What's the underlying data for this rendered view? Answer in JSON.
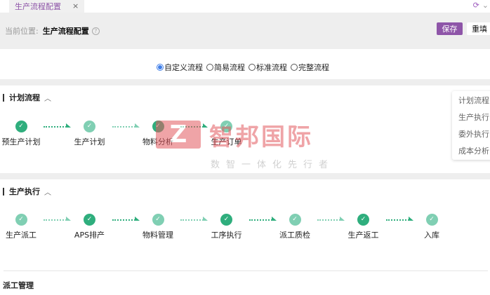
{
  "tabbar": {
    "tab_label": "生产流程配置",
    "close_icon": "×",
    "refresh_icon": "refresh-icon",
    "chevron_icon": "chevron-down-icon"
  },
  "header": {
    "location_label": "当前位置:",
    "location_value": "生产流程配置",
    "help_icon": "?",
    "save_label": "保存",
    "reset_label": "重填"
  },
  "colors": {
    "accent": "#8e55a8",
    "step_done": "#2fae7d",
    "step_light": "#80cfb3",
    "radio": "#3f7ee8"
  },
  "flow_types": [
    {
      "label": "自定义流程",
      "selected": true
    },
    {
      "label": "简易流程",
      "selected": false
    },
    {
      "label": "标准流程",
      "selected": false
    },
    {
      "label": "完整流程",
      "selected": false
    }
  ],
  "sections": [
    {
      "title": "计划流程",
      "steps": [
        {
          "label": "预生产计划",
          "tone": "dark"
        },
        {
          "label": "生产计划",
          "tone": "light"
        },
        {
          "label": "物料分析",
          "tone": "dark"
        },
        {
          "label": "生产订单",
          "tone": "light"
        }
      ]
    },
    {
      "title": "生产执行",
      "steps": [
        {
          "label": "生产派工",
          "tone": "light"
        },
        {
          "label": "APS排产",
          "tone": "dark"
        },
        {
          "label": "物料管理",
          "tone": "light"
        },
        {
          "label": "工序执行",
          "tone": "dark"
        },
        {
          "label": "派工质检",
          "tone": "light"
        },
        {
          "label": "生产返工",
          "tone": "dark"
        },
        {
          "label": "入库",
          "tone": "light"
        }
      ]
    }
  ],
  "sub_section": {
    "title": "派工管理"
  },
  "side_nav": [
    "计划流程",
    "生产执行",
    "委外执行",
    "成本分析"
  ],
  "watermark": {
    "logo_letter": "Z",
    "name": "智邦国际",
    "slogan": "数智一体化先行者"
  }
}
